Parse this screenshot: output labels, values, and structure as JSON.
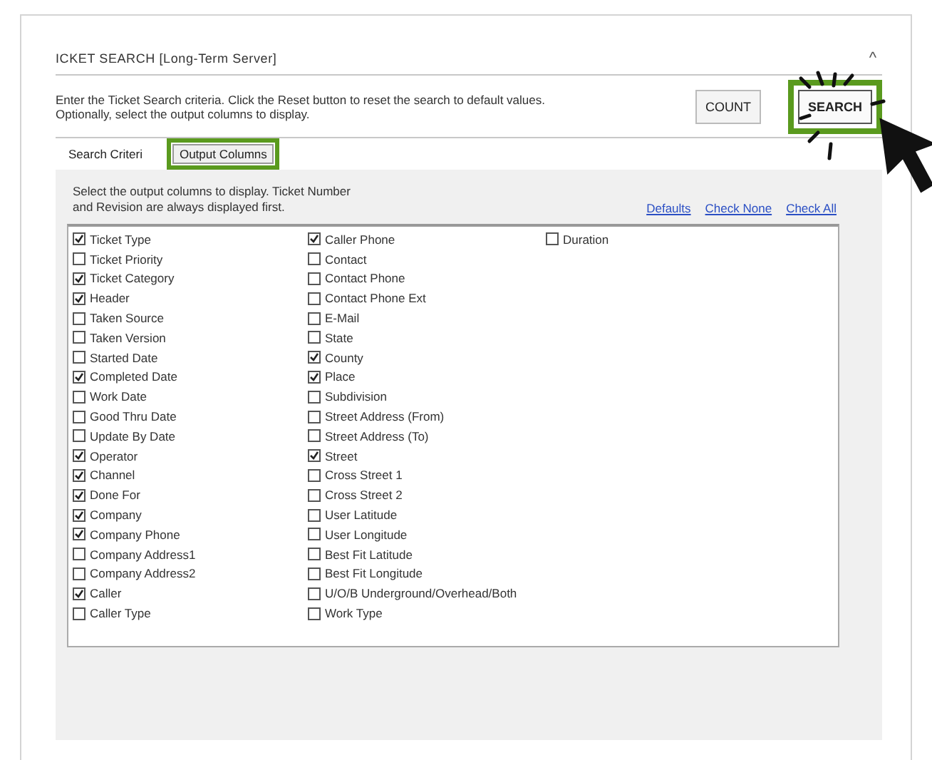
{
  "window": {
    "title": "ICKET SEARCH  [Long-Term Server]",
    "collapse_glyph": "^"
  },
  "instructions": [
    "Enter the Ticket Search criteria.  Click the Reset button to reset the search to default values.",
    "Optionally, select the output columns to display."
  ],
  "buttons": [
    {
      "label": "COUNT",
      "highlighted": false
    },
    {
      "label": "SEARCH",
      "highlighted": true
    }
  ],
  "tabs": [
    {
      "label": "Search Criteri",
      "selected": false,
      "highlighted": false
    },
    {
      "label": "Output Columns",
      "selected": true,
      "highlighted": true
    }
  ],
  "panel": {
    "hint": [
      "Select the output columns to display.  Ticket Number",
      "and Revision are always displayed first."
    ],
    "links": [
      "Defaults",
      "Check None",
      "Check All"
    ],
    "columns": [
      [
        {
          "label": "Ticket Type",
          "checked": true
        },
        {
          "label": "Ticket Priority",
          "checked": false
        },
        {
          "label": "Ticket Category",
          "checked": true
        },
        {
          "label": "Header",
          "checked": true
        },
        {
          "label": "Taken Source",
          "checked": false
        },
        {
          "label": "Taken Version",
          "checked": false
        },
        {
          "label": "Started Date",
          "checked": false
        },
        {
          "label": "Completed Date",
          "checked": true
        },
        {
          "label": "Work Date",
          "checked": false
        },
        {
          "label": "Good Thru Date",
          "checked": false
        },
        {
          "label": "Update By Date",
          "checked": false
        },
        {
          "label": "Operator",
          "checked": true
        },
        {
          "label": "Channel",
          "checked": true
        },
        {
          "label": "Done For",
          "checked": true
        },
        {
          "label": "Company",
          "checked": true
        },
        {
          "label": "Company Phone",
          "checked": true
        },
        {
          "label": "Company Address1",
          "checked": false
        },
        {
          "label": "Company Address2",
          "checked": false
        },
        {
          "label": "Caller",
          "checked": true
        },
        {
          "label": "Caller Type",
          "checked": false
        }
      ],
      [
        {
          "label": "Caller Phone",
          "checked": true
        },
        {
          "label": "Contact",
          "checked": false
        },
        {
          "label": "Contact Phone",
          "checked": false
        },
        {
          "label": "Contact Phone Ext",
          "checked": false
        },
        {
          "label": "E-Mail",
          "checked": false
        },
        {
          "label": "State",
          "checked": false
        },
        {
          "label": "County",
          "checked": true
        },
        {
          "label": "Place",
          "checked": true
        },
        {
          "label": "Subdivision",
          "checked": false
        },
        {
          "label": "Street Address (From)",
          "checked": false
        },
        {
          "label": "Street Address (To)",
          "checked": false
        },
        {
          "label": "Street",
          "checked": true
        },
        {
          "label": "Cross Street 1",
          "checked": false
        },
        {
          "label": "Cross Street 2",
          "checked": false
        },
        {
          "label": "User Latitude",
          "checked": false
        },
        {
          "label": "User Longitude",
          "checked": false
        },
        {
          "label": "Best Fit Latitude",
          "checked": false
        },
        {
          "label": "Best Fit Longitude",
          "checked": false
        },
        {
          "label": "U/O/B Underground/Overhead/Both",
          "checked": false
        },
        {
          "label": "Work Type",
          "checked": false
        }
      ],
      [
        {
          "label": "Duration",
          "checked": false
        }
      ]
    ]
  }
}
